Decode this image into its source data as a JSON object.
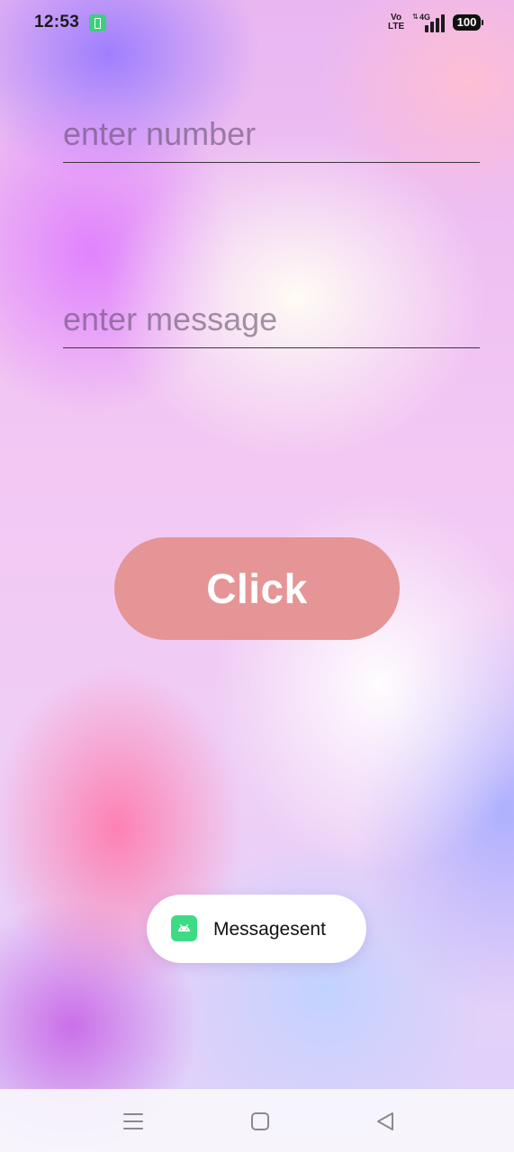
{
  "status_bar": {
    "time": "12:53",
    "volte_label_top": "Vo",
    "volte_label_bottom": "LTE",
    "network_label": "4G",
    "battery_level": "100",
    "icons": [
      "battery-saver-icon",
      "volte-icon",
      "signal-icon",
      "battery-icon"
    ]
  },
  "form": {
    "number_placeholder": "enter number",
    "number_value": "",
    "message_placeholder": "enter message",
    "message_value": ""
  },
  "button": {
    "label": "Click",
    "color": "#e59595"
  },
  "toast": {
    "text": "Messagesent",
    "icon": "android-icon",
    "icon_color": "#3ddc84"
  },
  "nav_bar": {
    "icons": [
      "menu-icon",
      "home-icon",
      "back-icon"
    ]
  }
}
